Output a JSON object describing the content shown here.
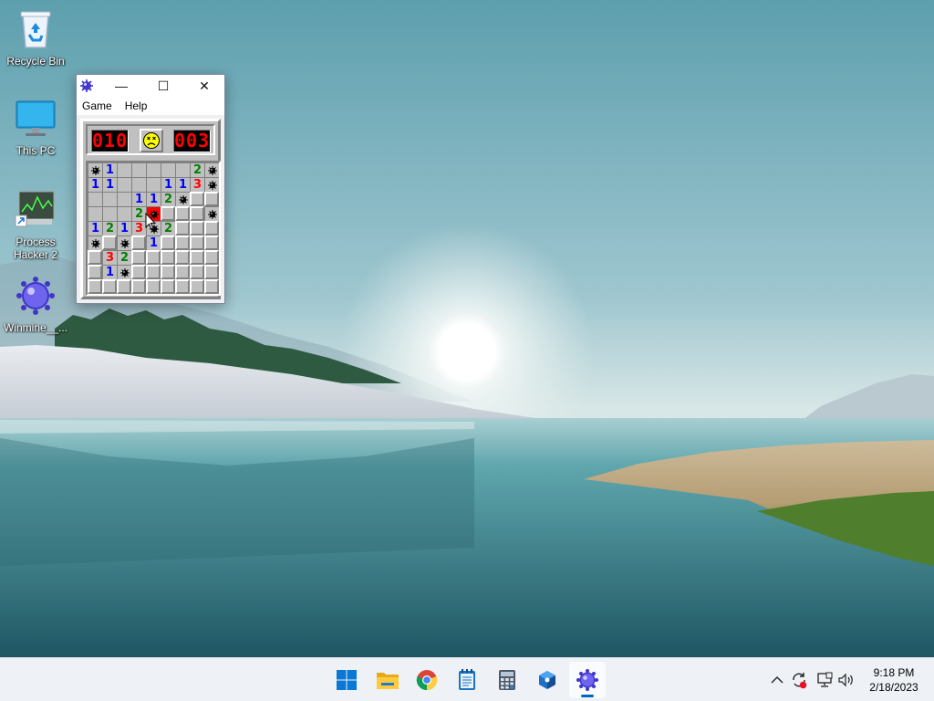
{
  "desktop": {
    "icons": [
      {
        "label": "Recycle Bin",
        "icon": "recycle-bin-icon"
      },
      {
        "label": "This PC",
        "icon": "monitor-icon"
      },
      {
        "label": "Process\nHacker 2",
        "icon": "process-hacker-icon"
      },
      {
        "label": "Winmine__...",
        "icon": "minesweeper-icon"
      }
    ]
  },
  "window": {
    "title": "",
    "minimize_glyph": "—",
    "maximize_glyph": "☐",
    "close_glyph": "✕",
    "menu": [
      "Game",
      "Help"
    ]
  },
  "game": {
    "mine_counter": "010",
    "timer": "003",
    "face_state": "dead",
    "status": "lost",
    "rows": [
      [
        "M",
        "1",
        "",
        "",
        "",
        "",
        "",
        "2",
        "M"
      ],
      [
        "1",
        "1",
        "",
        "",
        "",
        "1",
        "1",
        "3",
        "M"
      ],
      [
        "",
        "",
        "",
        "1",
        "1",
        "2",
        "M",
        "H",
        "H"
      ],
      [
        "",
        "",
        "",
        "2",
        "X",
        "H",
        "H",
        "H",
        "M"
      ],
      [
        "1",
        "2",
        "1",
        "3",
        "M",
        "2",
        "H",
        "H",
        "H"
      ],
      [
        "M",
        "H",
        "M",
        "H",
        "1",
        "H",
        "H",
        "H",
        "H"
      ],
      [
        "H",
        "3",
        "2",
        "H",
        "H",
        "H",
        "H",
        "H",
        "H"
      ],
      [
        "H",
        "1",
        "M",
        "H",
        "H",
        "H",
        "H",
        "H",
        "H"
      ],
      [
        "H",
        "H",
        "H",
        "H",
        "H",
        "H",
        "H",
        "H",
        "H"
      ]
    ],
    "legend": {
      "M": "mine",
      "X": "exploded-mine",
      "H": "hidden",
      "": "empty"
    },
    "colors": {
      "1": "#0000ff",
      "2": "#008000",
      "3": "#ff0000",
      "exploded": "#ff0000"
    }
  },
  "taskbar": {
    "apps": [
      {
        "name": "start",
        "icon": "windows-start-icon",
        "active": false
      },
      {
        "name": "file-explorer",
        "icon": "folder-icon",
        "active": false
      },
      {
        "name": "chrome",
        "icon": "chrome-icon",
        "active": false
      },
      {
        "name": "notepad",
        "icon": "notepad-icon",
        "active": false
      },
      {
        "name": "calculator",
        "icon": "calculator-icon",
        "active": false
      },
      {
        "name": "app",
        "icon": "cube-app-icon",
        "active": false
      },
      {
        "name": "minesweeper",
        "icon": "minesweeper-icon",
        "active": true
      }
    ],
    "tray": {
      "icons": [
        "chevron-up-icon",
        "sync-alert-icon",
        "network-icon",
        "volume-icon"
      ],
      "time": "9:18 PM",
      "date": "2/18/2023"
    },
    "accent": "#0067c0"
  }
}
